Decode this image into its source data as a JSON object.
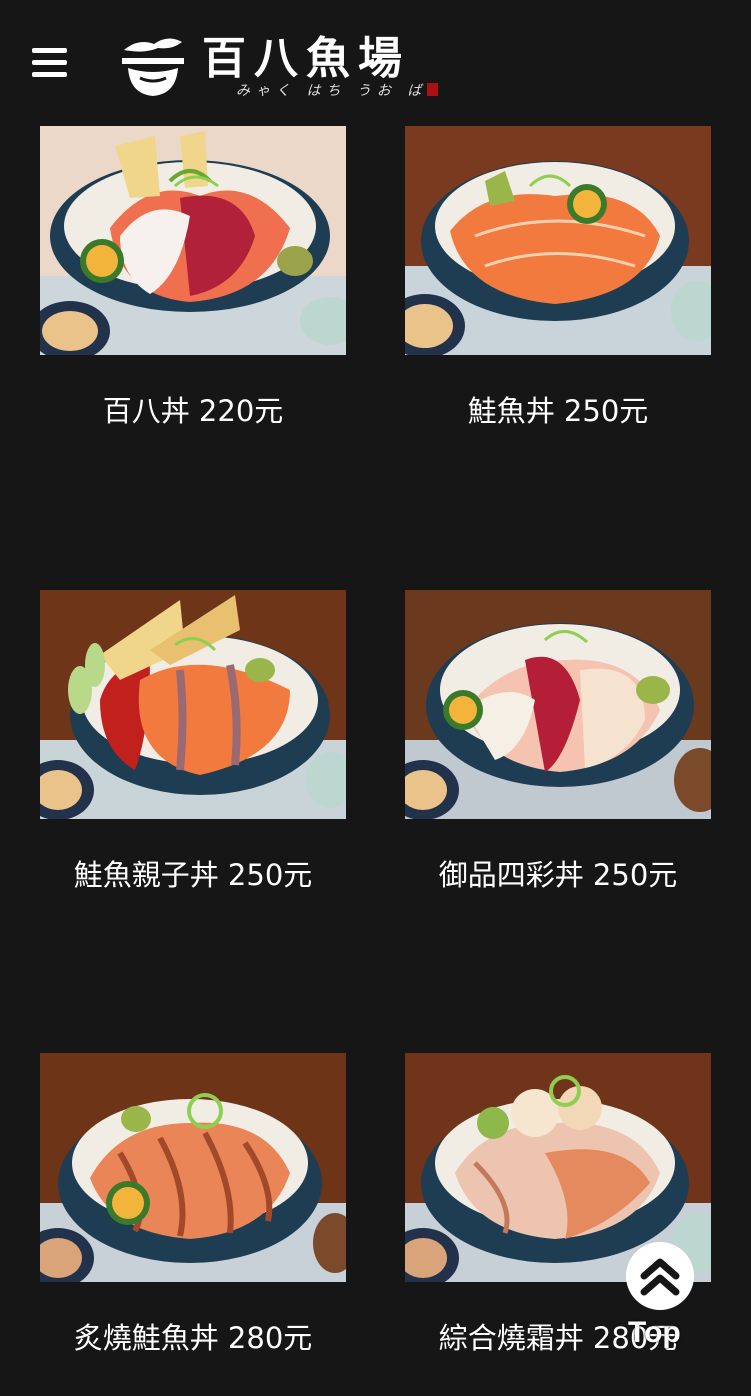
{
  "header": {
    "logo_text": "百八魚場",
    "logo_subtext": "みゃく はち うお ば"
  },
  "menu_items": [
    {
      "label": "百八丼 220元",
      "theme": "mixed"
    },
    {
      "label": "鮭魚丼 250元",
      "theme": "salmon"
    },
    {
      "label": "鮭魚親子丼 250元",
      "theme": "salmon-roe"
    },
    {
      "label": "御品四彩丼 250元",
      "theme": "four-color"
    },
    {
      "label": "炙燒鮭魚丼 280元",
      "theme": "seared-salmon"
    },
    {
      "label": "綜合燒霜丼 280元",
      "theme": "seared-mixed"
    }
  ],
  "back_to_top": {
    "label": "Top"
  }
}
